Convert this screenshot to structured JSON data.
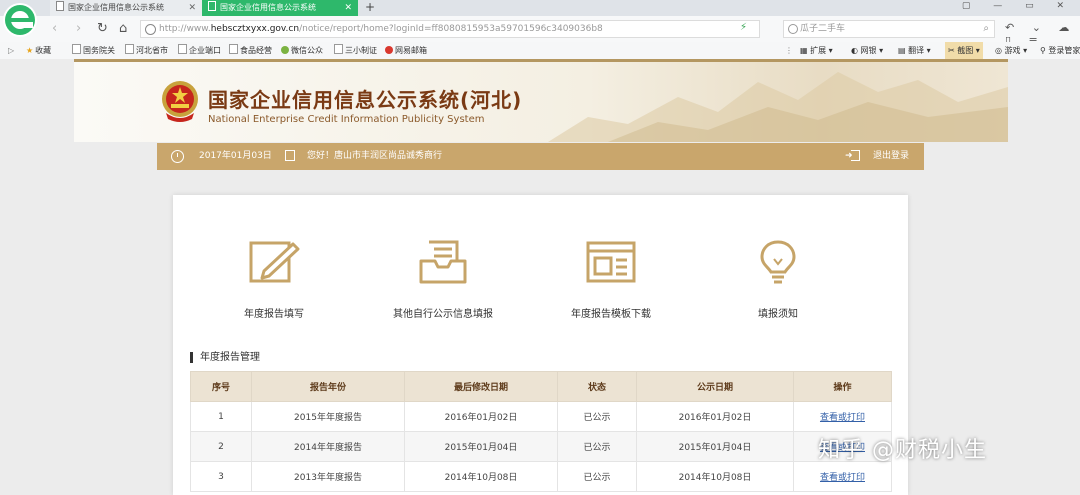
{
  "browser": {
    "tabs": [
      {
        "title": "国家企业信用信息公示系统",
        "active": false
      },
      {
        "title": "国家企业信用信息公示系统",
        "active": true
      }
    ],
    "new_tab_symbol": "+",
    "window_controls": "▢ — ▭ ✕",
    "url": {
      "prefix": "http://www.",
      "host": "hebscztxyxx.gov.cn",
      "path": "/notice/report/home?loginId=ff8080815953a59701596c3409036b8"
    },
    "search": {
      "placeholder": "瓜子二手车"
    },
    "nav_tools": "↶ ⌄ ☁ ▯ ≡",
    "bookmarks": [
      {
        "label": "收藏",
        "icon": "star-icon"
      },
      {
        "label": "国务院关",
        "icon": "page-icon"
      },
      {
        "label": "河北省市",
        "icon": "page-icon"
      },
      {
        "label": "企业端口",
        "icon": "page-icon"
      },
      {
        "label": "食品经营",
        "icon": "page-icon"
      },
      {
        "label": "微信公众",
        "icon": "wechat-icon"
      },
      {
        "label": "三小制证",
        "icon": "page-icon"
      },
      {
        "label": "网易邮箱",
        "icon": "mail-icon"
      }
    ],
    "bookmark_tools": [
      {
        "label": "扩展"
      },
      {
        "label": "网银"
      },
      {
        "label": "翻译"
      },
      {
        "label": "截图"
      },
      {
        "label": "游戏"
      },
      {
        "label": "登录管家"
      }
    ]
  },
  "header": {
    "title": "国家企业信用信息公示系统(河北)",
    "subtitle": "National Enterprise Credit Information Publicity System"
  },
  "infobar": {
    "date": "2017年01月03日",
    "greeting": "您好！唐山市丰润区尚品诚秀商行",
    "logout": "退出登录"
  },
  "functions": [
    {
      "label": "年度报告填写",
      "icon": "edit-report-icon"
    },
    {
      "label": "其他自行公示信息填报",
      "icon": "inbox-tray-icon"
    },
    {
      "label": "年度报告模板下载",
      "icon": "template-window-icon"
    },
    {
      "label": "填报须知",
      "icon": "lightbulb-icon"
    }
  ],
  "section": {
    "title": "年度报告管理"
  },
  "table": {
    "headers": [
      "序号",
      "报告年份",
      "最后修改日期",
      "状态",
      "公示日期",
      "操作"
    ],
    "rows": [
      [
        "1",
        "2015年年度报告",
        "2016年01月02日",
        "已公示",
        "2016年01月02日",
        "查看或打印"
      ],
      [
        "2",
        "2014年年度报告",
        "2015年01月04日",
        "已公示",
        "2015年01月04日",
        "查看或打印"
      ],
      [
        "3",
        "2013年年度报告",
        "2014年10月08日",
        "已公示",
        "2014年10月08日",
        "查看或打印"
      ]
    ]
  },
  "watermark": "知乎 @财税小生",
  "colors": {
    "accent": "#c9a66c",
    "title": "#7a3a14",
    "tab_active": "#2eb86b",
    "link": "#3360a8"
  }
}
